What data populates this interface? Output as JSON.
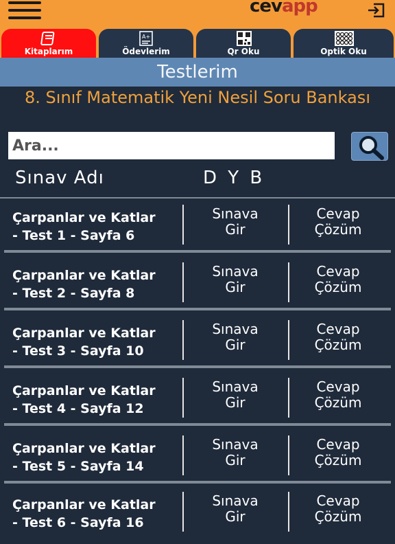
{
  "header": {
    "logo_part1": "cev",
    "logo_part2": "app"
  },
  "tabs": [
    {
      "label": "Kitaplarım",
      "icon": "book-icon",
      "active": true
    },
    {
      "label": "Ödevlerim",
      "icon": "homework-icon",
      "active": false
    },
    {
      "label": "Qr Oku",
      "icon": "qr-code-icon",
      "active": false
    },
    {
      "label": "Optik Oku",
      "icon": "optical-form-icon",
      "active": false
    }
  ],
  "page": {
    "heading": "Testlerim",
    "book_title": "8. Sınıf Matematik Yeni Nesil Soru Bankası"
  },
  "search": {
    "placeholder": "Ara..."
  },
  "table": {
    "col_name": "Sınav Adı",
    "col_dyb": "D Y B",
    "rows": [
      {
        "name_line1": "Çarpanlar ve Katlar",
        "name_line2": "- Test 1 - Sayfa 6",
        "enter_line1": "Sınava",
        "enter_line2": "Gir",
        "answer_line1": "Cevap",
        "answer_line2": "Çözüm"
      },
      {
        "name_line1": "Çarpanlar ve Katlar",
        "name_line2": "- Test 2 - Sayfa 8",
        "enter_line1": "Sınava",
        "enter_line2": "Gir",
        "answer_line1": "Cevap",
        "answer_line2": "Çözüm"
      },
      {
        "name_line1": "Çarpanlar ve Katlar",
        "name_line2": "- Test 3 - Sayfa 10",
        "enter_line1": "Sınava",
        "enter_line2": "Gir",
        "answer_line1": "Cevap",
        "answer_line2": "Çözüm"
      },
      {
        "name_line1": "Çarpanlar ve Katlar",
        "name_line2": "- Test 4 - Sayfa 12",
        "enter_line1": "Sınava",
        "enter_line2": "Gir",
        "answer_line1": "Cevap",
        "answer_line2": "Çözüm"
      },
      {
        "name_line1": "Çarpanlar ve Katlar",
        "name_line2": "- Test 5 - Sayfa 14",
        "enter_line1": "Sınava",
        "enter_line2": "Gir",
        "answer_line1": "Cevap",
        "answer_line2": "Çözüm"
      },
      {
        "name_line1": "Çarpanlar ve Katlar",
        "name_line2": "- Test 6 - Sayfa 16",
        "enter_line1": "Sınava",
        "enter_line2": "Gir",
        "answer_line1": "Cevap",
        "answer_line2": "Çözüm"
      }
    ]
  },
  "colors": {
    "top_bar": "#f49b38",
    "active_tab": "#ff0f0f",
    "tab": "#253449",
    "heading_strip": "#5f87b3",
    "background": "#1f2a3a",
    "book_title": "#f0a13c"
  }
}
